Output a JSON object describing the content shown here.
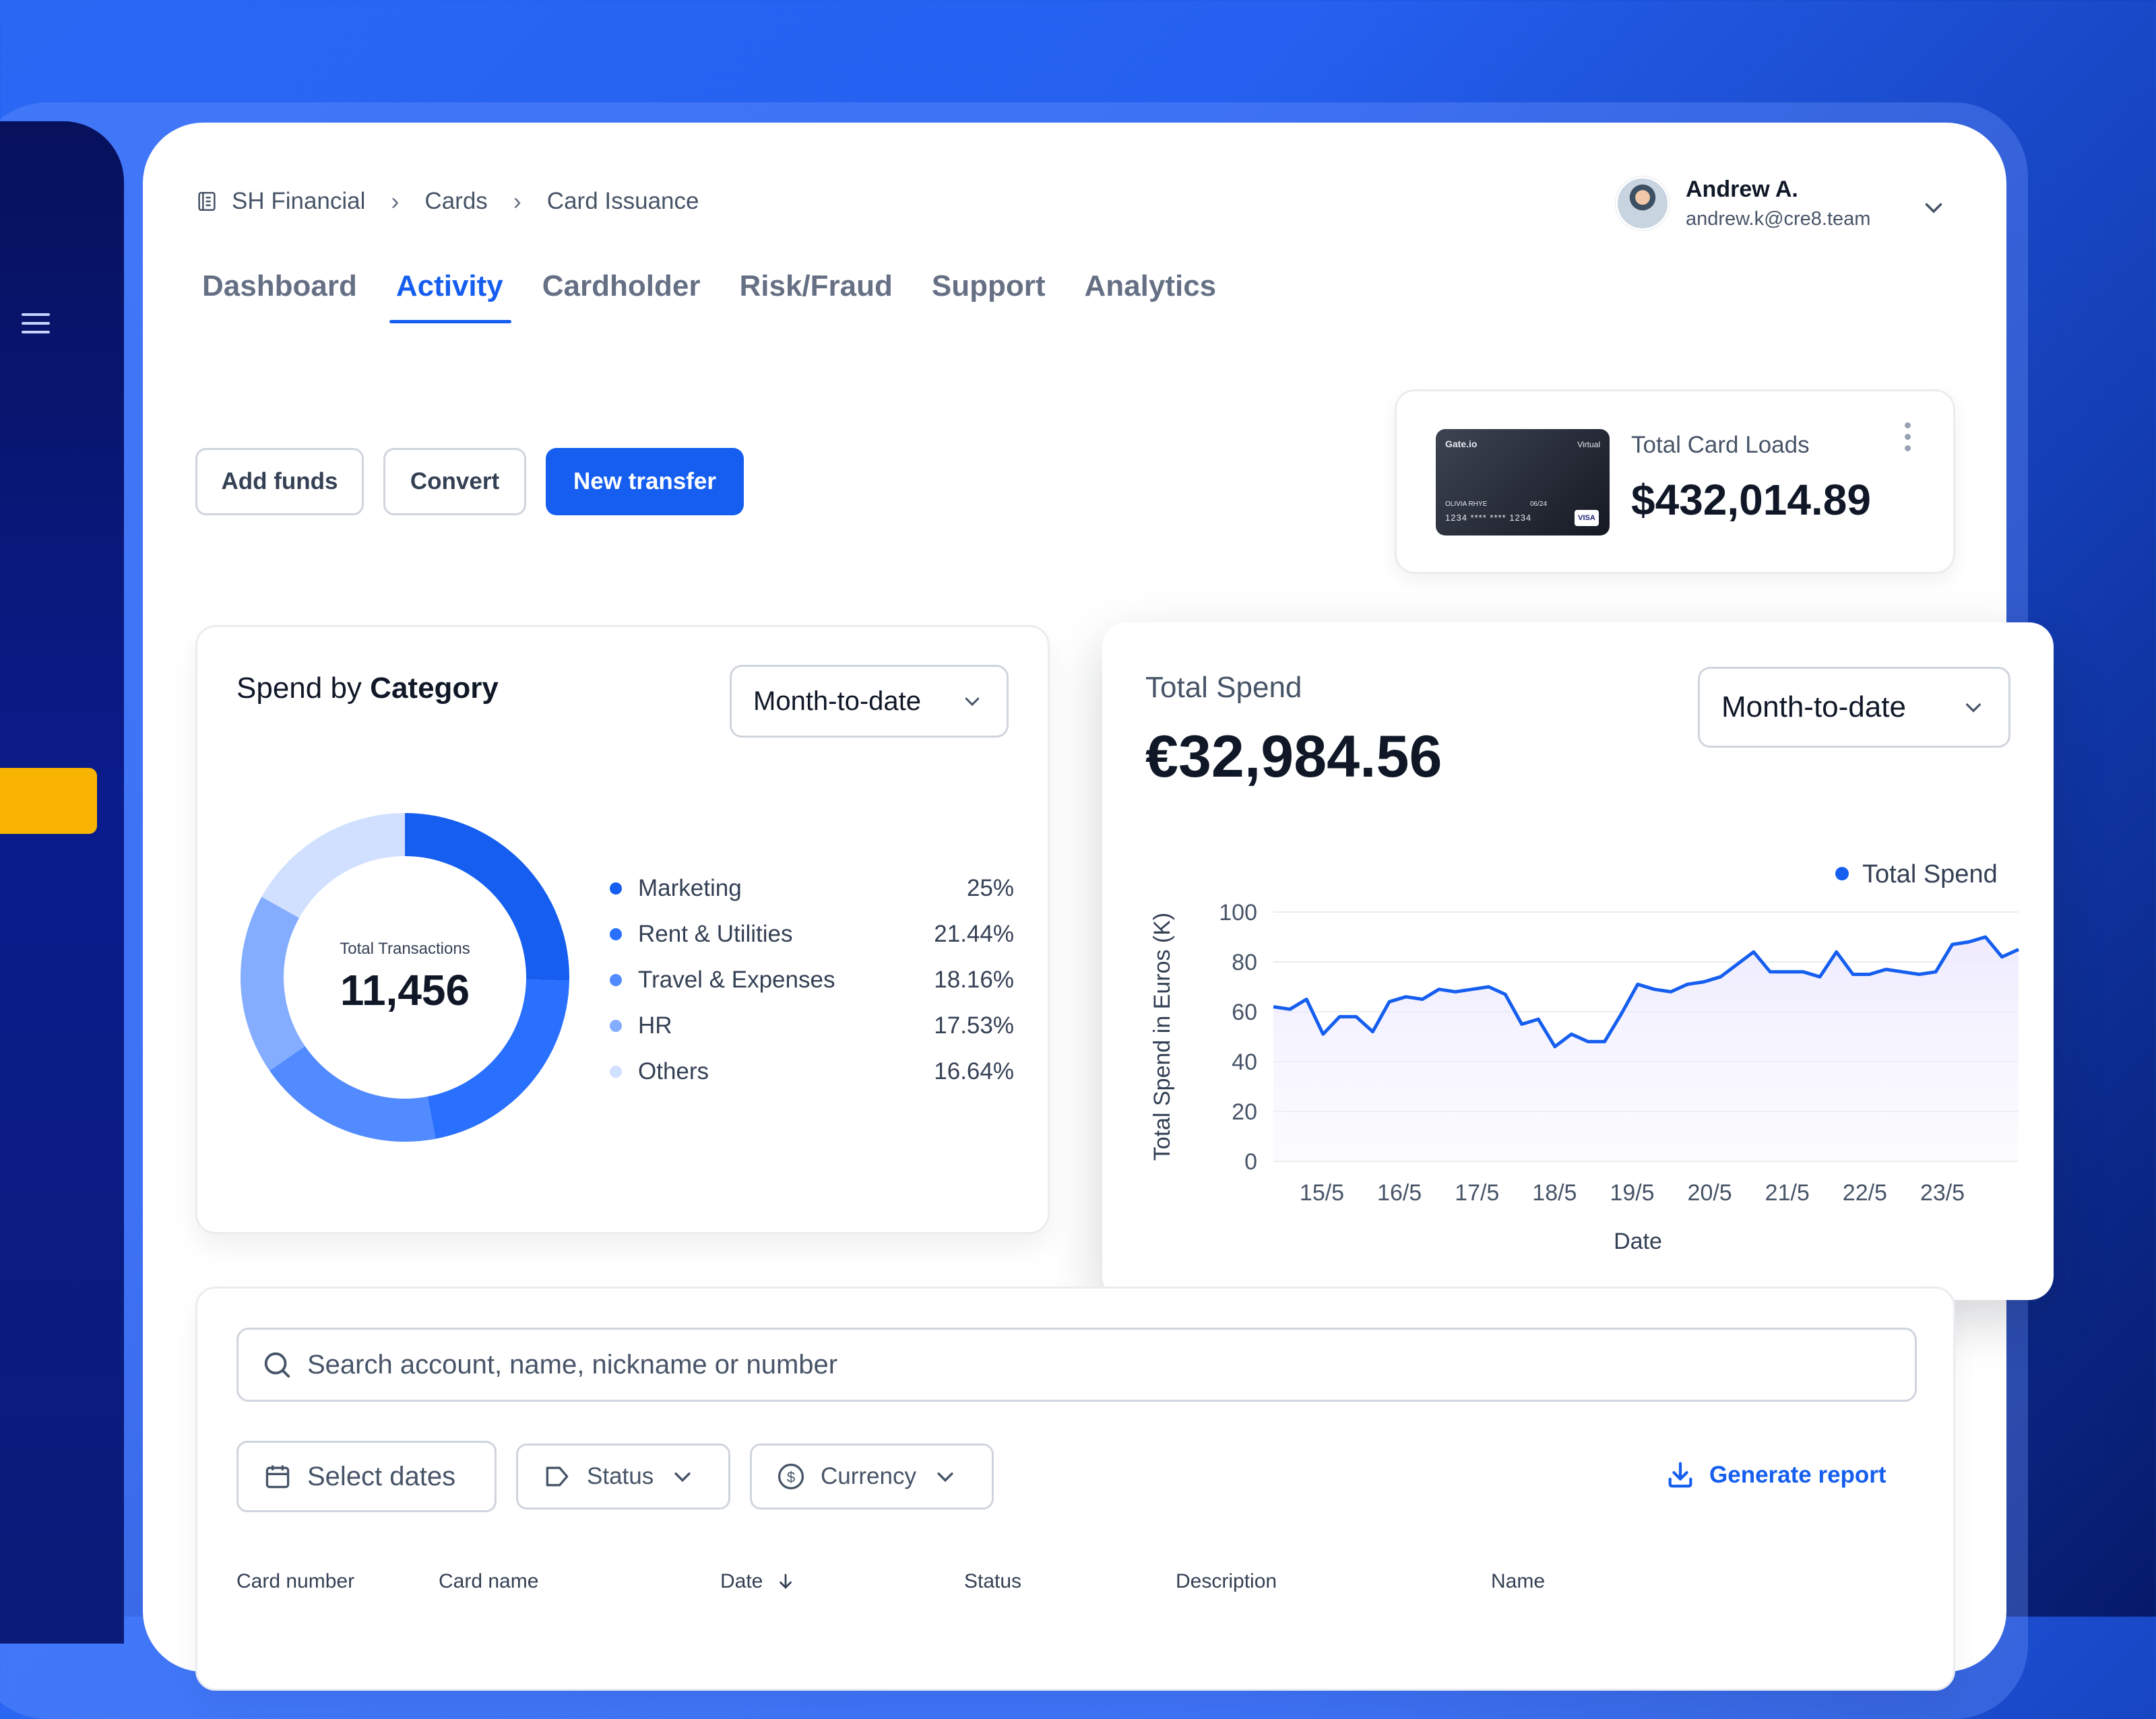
{
  "breadcrumb": [
    "SH Financial",
    "Cards",
    "Card Issuance"
  ],
  "user": {
    "name": "Andrew A.",
    "email": "andrew.k@cre8.team"
  },
  "tabs": [
    {
      "label": "Dashboard",
      "active": false
    },
    {
      "label": "Activity",
      "active": true
    },
    {
      "label": "Cardholder",
      "active": false
    },
    {
      "label": "Risk/Fraud",
      "active": false
    },
    {
      "label": "Support",
      "active": false
    },
    {
      "label": "Analytics",
      "active": false
    }
  ],
  "actions": {
    "add_funds": "Add funds",
    "convert": "Convert",
    "new_transfer": "New transfer"
  },
  "card_loads": {
    "title": "Total Card Loads",
    "value": "$432,014.89",
    "card": {
      "brand": "Gate.io",
      "type": "Virtual",
      "holder": "OLIVIA RHYE",
      "expiry": "06/24",
      "number": "1234 **** **** 1234",
      "network": "VISA"
    }
  },
  "spend_by_category": {
    "title_prefix": "Spend by",
    "title_bold": "Category",
    "period": "Month-to-date",
    "center_label": "Total Transactions",
    "center_value": "11,456"
  },
  "total_spend": {
    "title": "Total Spend",
    "value": "€32,984.56",
    "period": "Month-to-date"
  },
  "chart_data": [
    {
      "type": "pie",
      "categories": [
        "Marketing",
        "Rent & Utilities",
        "Travel & Expenses",
        "HR",
        "Others"
      ],
      "values": [
        25,
        21.44,
        18.16,
        17.53,
        16.64
      ],
      "labels": [
        "25%",
        "21.44%",
        "18.16%",
        "17.53%",
        "16.64%"
      ],
      "colors": [
        "#155eef",
        "#2970ff",
        "#528bff",
        "#84adff",
        "#d1e0ff"
      ]
    },
    {
      "type": "area",
      "legend": "Total Spend",
      "legend_position": "top-right",
      "xlabel": "Date",
      "ylabel": "Total Spend in  Euros (K)",
      "x_ticks": [
        "15/5",
        "16/5",
        "17/5",
        "18/5",
        "19/5",
        "20/5",
        "21/5",
        "22/5",
        "23/5"
      ],
      "ylim": [
        0,
        100
      ],
      "y_ticks": [
        0,
        20,
        40,
        60,
        80,
        100
      ],
      "grid": true,
      "color": "#155eef",
      "values": [
        62,
        61,
        65,
        51,
        58,
        58,
        52,
        64,
        66,
        65,
        69,
        68,
        69,
        70,
        67,
        55,
        57,
        46,
        51,
        48,
        48,
        59,
        71,
        69,
        68,
        71,
        72,
        74,
        79,
        84,
        76,
        76,
        76,
        74,
        84,
        75,
        75,
        77,
        76,
        75,
        76,
        87,
        88,
        90,
        82,
        85
      ]
    }
  ],
  "search": {
    "placeholder": "Search account, name, nickname or number"
  },
  "filters": {
    "dates": "Select dates",
    "status": "Status",
    "currency": "Currency"
  },
  "generate_report": "Generate report",
  "table": {
    "columns": [
      "Card number",
      "Card name",
      "Date",
      "Status",
      "Description",
      "Name"
    ]
  },
  "colors": {
    "accent": "#155eef",
    "sidebar": "#0a1c8c",
    "sidebar_highlight": "#f8b400"
  },
  "icons": {
    "menu": "hamburger-icon",
    "breadcrumb": "building-icon",
    "search": "search-icon",
    "calendar": "calendar-icon",
    "tag": "tag-icon",
    "currency": "dollar-circle-icon",
    "download": "download-icon"
  }
}
